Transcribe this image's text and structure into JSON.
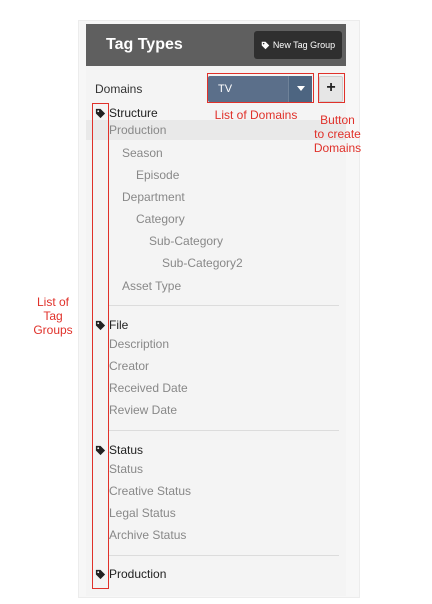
{
  "header": {
    "title": "Tag Types",
    "new_tag_group_label": "New Tag Group"
  },
  "domains": {
    "label": "Domains",
    "selected": "TV",
    "add_label": "+"
  },
  "groups": [
    {
      "title": "Structure",
      "items": [
        "Production",
        "Season",
        "Episode",
        "Department",
        "Category",
        "Sub-Category",
        "Sub-Category2",
        "Asset Type"
      ]
    },
    {
      "title": "File",
      "items": [
        "Description",
        "Creator",
        "Received Date",
        "Review Date"
      ]
    },
    {
      "title": "Status",
      "items": [
        "Status",
        "Creative Status",
        "Legal Status",
        "Archive Status"
      ]
    },
    {
      "title": "Production",
      "items": []
    }
  ],
  "annotations": {
    "list_of_domains": "List of Domains",
    "button_create_domains": [
      "Button",
      "to create",
      "Domains"
    ],
    "list_of_tag_groups": [
      "List of",
      "Tag",
      "Groups"
    ]
  },
  "colors": {
    "accent": "#e0312a",
    "header_bg": "#5f5f5f",
    "select_bg": "#5b6f8a"
  }
}
